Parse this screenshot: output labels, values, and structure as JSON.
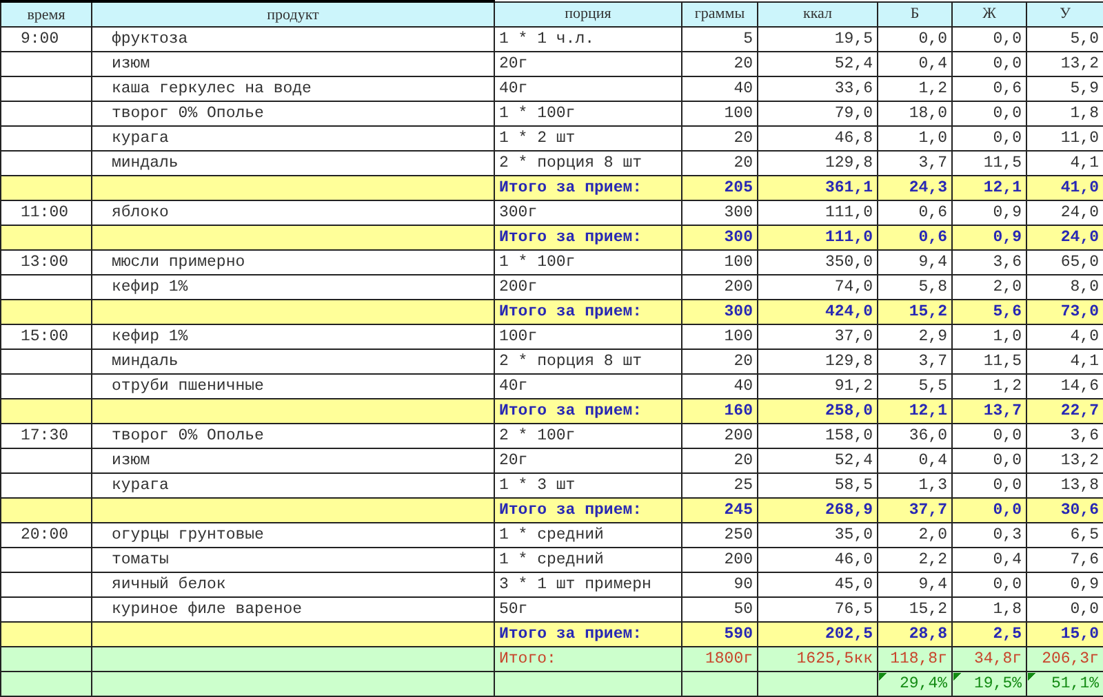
{
  "columns": [
    "время",
    "продукт",
    "порция",
    "граммы",
    "ккал",
    "Б",
    "Ж",
    "У"
  ],
  "rows": [
    {
      "kind": "item",
      "time": "9:00",
      "product": "фруктоза",
      "portion": "1 * 1 ч.л.",
      "grams": "5",
      "kcal": "19,5",
      "b": "0,0",
      "zh": "0,0",
      "u": "5,0"
    },
    {
      "kind": "item",
      "product": "изюм",
      "portion": "20г",
      "grams": "20",
      "kcal": "52,4",
      "b": "0,4",
      "zh": "0,0",
      "u": "13,2"
    },
    {
      "kind": "item",
      "product": "каша геркулес на воде",
      "portion": "40г",
      "grams": "40",
      "kcal": "33,6",
      "b": "1,2",
      "zh": "0,6",
      "u": "5,9"
    },
    {
      "kind": "item",
      "product": "творог 0% Ополье",
      "portion": "1 * 100г",
      "grams": "100",
      "kcal": "79,0",
      "b": "18,0",
      "zh": "0,0",
      "u": "1,8"
    },
    {
      "kind": "item",
      "product": "курага",
      "portion": "1 * 2 шт",
      "grams": "20",
      "kcal": "46,8",
      "b": "1,0",
      "zh": "0,0",
      "u": "11,0"
    },
    {
      "kind": "item",
      "product": "миндаль",
      "portion": "2 * порция 8 шт",
      "grams": "20",
      "kcal": "129,8",
      "b": "3,7",
      "zh": "11,5",
      "u": "4,1"
    },
    {
      "kind": "subtotal",
      "portion": "Итого за прием:",
      "grams": "205",
      "kcal": "361,1",
      "b": "24,3",
      "zh": "12,1",
      "u": "41,0"
    },
    {
      "kind": "item",
      "time": "11:00",
      "product": "яблоко",
      "portion": "300г",
      "grams": "300",
      "kcal": "111,0",
      "b": "0,6",
      "zh": "0,9",
      "u": "24,0"
    },
    {
      "kind": "subtotal",
      "portion": "Итого за прием:",
      "grams": "300",
      "kcal": "111,0",
      "b": "0,6",
      "zh": "0,9",
      "u": "24,0"
    },
    {
      "kind": "item",
      "time": "13:00",
      "product": "мюсли примерно",
      "portion": "1 * 100г",
      "grams": "100",
      "kcal": "350,0",
      "b": "9,4",
      "zh": "3,6",
      "u": "65,0"
    },
    {
      "kind": "item",
      "product": "кефир 1%",
      "portion": "200г",
      "grams": "200",
      "kcal": "74,0",
      "b": "5,8",
      "zh": "2,0",
      "u": "8,0"
    },
    {
      "kind": "subtotal",
      "portion": "Итого за прием:",
      "grams": "300",
      "kcal": "424,0",
      "b": "15,2",
      "zh": "5,6",
      "u": "73,0"
    },
    {
      "kind": "item",
      "time": "15:00",
      "product": "кефир 1%",
      "portion": "100г",
      "grams": "100",
      "kcal": "37,0",
      "b": "2,9",
      "zh": "1,0",
      "u": "4,0"
    },
    {
      "kind": "item",
      "product": "миндаль",
      "portion": "2 * порция 8 шт",
      "grams": "20",
      "kcal": "129,8",
      "b": "3,7",
      "zh": "11,5",
      "u": "4,1"
    },
    {
      "kind": "item",
      "product": "отруби пшеничные",
      "portion": "40г",
      "grams": "40",
      "kcal": "91,2",
      "b": "5,5",
      "zh": "1,2",
      "u": "14,6"
    },
    {
      "kind": "subtotal",
      "portion": "Итого за прием:",
      "grams": "160",
      "kcal": "258,0",
      "b": "12,1",
      "zh": "13,7",
      "u": "22,7"
    },
    {
      "kind": "item",
      "time": "17:30",
      "product": "творог 0% Ополье",
      "portion": "2 * 100г",
      "grams": "200",
      "kcal": "158,0",
      "b": "36,0",
      "zh": "0,0",
      "u": "3,6"
    },
    {
      "kind": "item",
      "product": "изюм",
      "portion": "20г",
      "grams": "20",
      "kcal": "52,4",
      "b": "0,4",
      "zh": "0,0",
      "u": "13,2"
    },
    {
      "kind": "item",
      "product": "курага",
      "portion": "1 * 3 шт",
      "grams": "25",
      "kcal": "58,5",
      "b": "1,3",
      "zh": "0,0",
      "u": "13,8"
    },
    {
      "kind": "subtotal",
      "portion": "Итого за прием:",
      "grams": "245",
      "kcal": "268,9",
      "b": "37,7",
      "zh": "0,0",
      "u": "30,6"
    },
    {
      "kind": "item",
      "time": "20:00",
      "product": "огурцы грунтовые",
      "portion": "1 * средний",
      "grams": "250",
      "kcal": "35,0",
      "b": "2,0",
      "zh": "0,3",
      "u": "6,5"
    },
    {
      "kind": "item",
      "product": "томаты",
      "portion": "1 * средний",
      "grams": "200",
      "kcal": "46,0",
      "b": "2,2",
      "zh": "0,4",
      "u": "7,6"
    },
    {
      "kind": "item",
      "product": "яичный белок",
      "portion": "3 * 1 шт примерн",
      "grams": "90",
      "kcal": "45,0",
      "b": "9,4",
      "zh": "0,0",
      "u": "0,9"
    },
    {
      "kind": "item",
      "product": "куриное филе вареное",
      "portion": "50г",
      "grams": "50",
      "kcal": "76,5",
      "b": "15,2",
      "zh": "1,8",
      "u": "0,0"
    },
    {
      "kind": "subtotal",
      "portion": "Итого за прием:",
      "grams": "590",
      "kcal": "202,5",
      "b": "28,8",
      "zh": "2,5",
      "u": "15,0"
    },
    {
      "kind": "total",
      "portion": "Итого:",
      "grams": "1800г",
      "kcal": "1625,5кк",
      "b": "118,8г",
      "zh": "34,8г",
      "u": "206,3г"
    },
    {
      "kind": "percent",
      "b": "29,4%",
      "zh": "19,5%",
      "u": "51,1%"
    }
  ]
}
